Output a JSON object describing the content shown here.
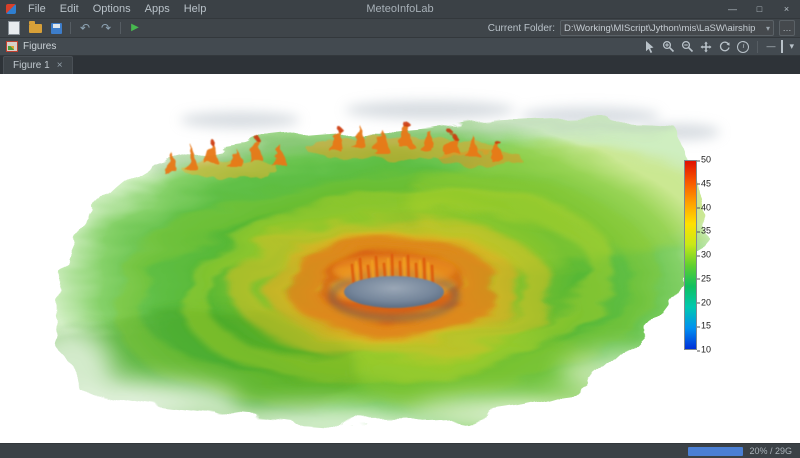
{
  "window": {
    "app_title": "MeteoInfoLab",
    "menu_items": [
      "File",
      "Edit",
      "Options",
      "Apps",
      "Help"
    ],
    "controls": {
      "minimize": "—",
      "maximize": "□",
      "close": "×"
    }
  },
  "toolbar": {
    "current_folder_label": "Current Folder:",
    "current_folder_path": "D:\\Working\\MIScript\\Jython\\mis\\LaSW\\airship",
    "icons": {
      "undo": "↶",
      "redo": "↷",
      "run": "▶",
      "dropdown": "▾",
      "more": "…"
    }
  },
  "figures": {
    "panel_title": "Figures",
    "tab_label": "Figure 1",
    "tab_close_glyph": "×",
    "icons": {
      "info": "i",
      "minimize": "—",
      "chevron": "▾"
    }
  },
  "status": {
    "memory_text": "20% / 29G"
  },
  "chart_data": {
    "type": "3d-volume",
    "description": "3D volume rendering of a tropical cyclone cloud field viewed obliquely: green rainband shield, orange/red eyewall convection ring and a dark central eye",
    "colorbar": {
      "min": 10,
      "max": 50,
      "tick_labels": [
        "50",
        "45",
        "40",
        "35",
        "30",
        "25",
        "20",
        "15",
        "10"
      ],
      "colors_top_to_bottom": [
        "#e01000",
        "#f85800",
        "#ffa000",
        "#ffe000",
        "#c8e818",
        "#60d030",
        "#10c060",
        "#00c8b0",
        "#0090f0",
        "#0030d8"
      ]
    }
  }
}
